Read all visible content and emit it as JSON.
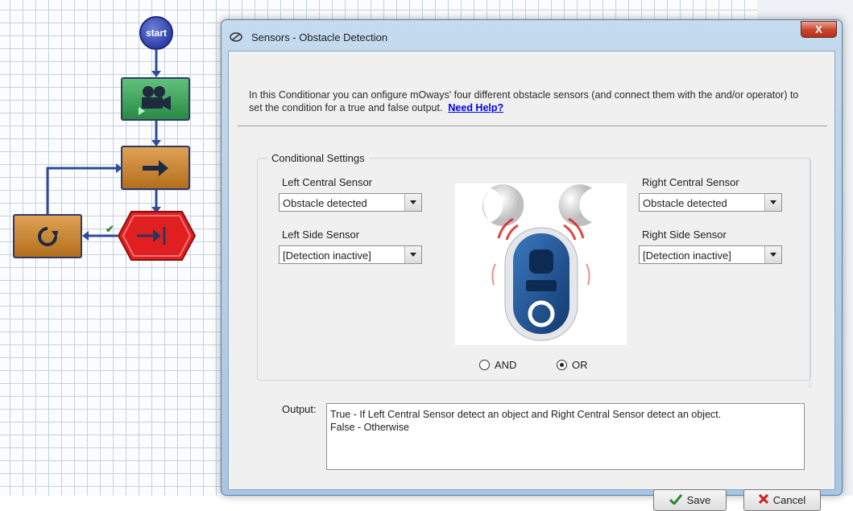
{
  "canvas": {
    "start_label": "start",
    "true_branch_mark": "✔"
  },
  "dialog": {
    "title": "Sensors - Obstacle Detection",
    "close_label": "X",
    "intro_text": "In this Conditionar you can onfigure mOways' four different obstacle sensors (and connect them with the and/or operator) to set the condition for a true and false output.",
    "help_link": "Need Help?",
    "group_title": "Conditional Settings",
    "left_central": {
      "label": "Left Central Sensor",
      "value": "Obstacle detected"
    },
    "left_side": {
      "label": "Left Side Sensor",
      "value": "[Detection inactive]"
    },
    "right_central": {
      "label": "Right Central Sensor",
      "value": "Obstacle detected"
    },
    "right_side": {
      "label": "Right Side Sensor",
      "value": "[Detection inactive]"
    },
    "operator": {
      "and_label": "AND",
      "or_label": "OR",
      "selected": "OR"
    },
    "output_label": "Output:",
    "output_line1": "True - If Left Central Sensor detect an object and Right Central Sensor detect an object.",
    "output_line2": "False - Otherwise",
    "save_label": "Save",
    "cancel_label": "Cancel"
  },
  "colors": {
    "accent_link": "#0000ee",
    "close_button": "#c7432b",
    "robot_blue": "#1e4f8c",
    "condition_red": "#e02020"
  }
}
